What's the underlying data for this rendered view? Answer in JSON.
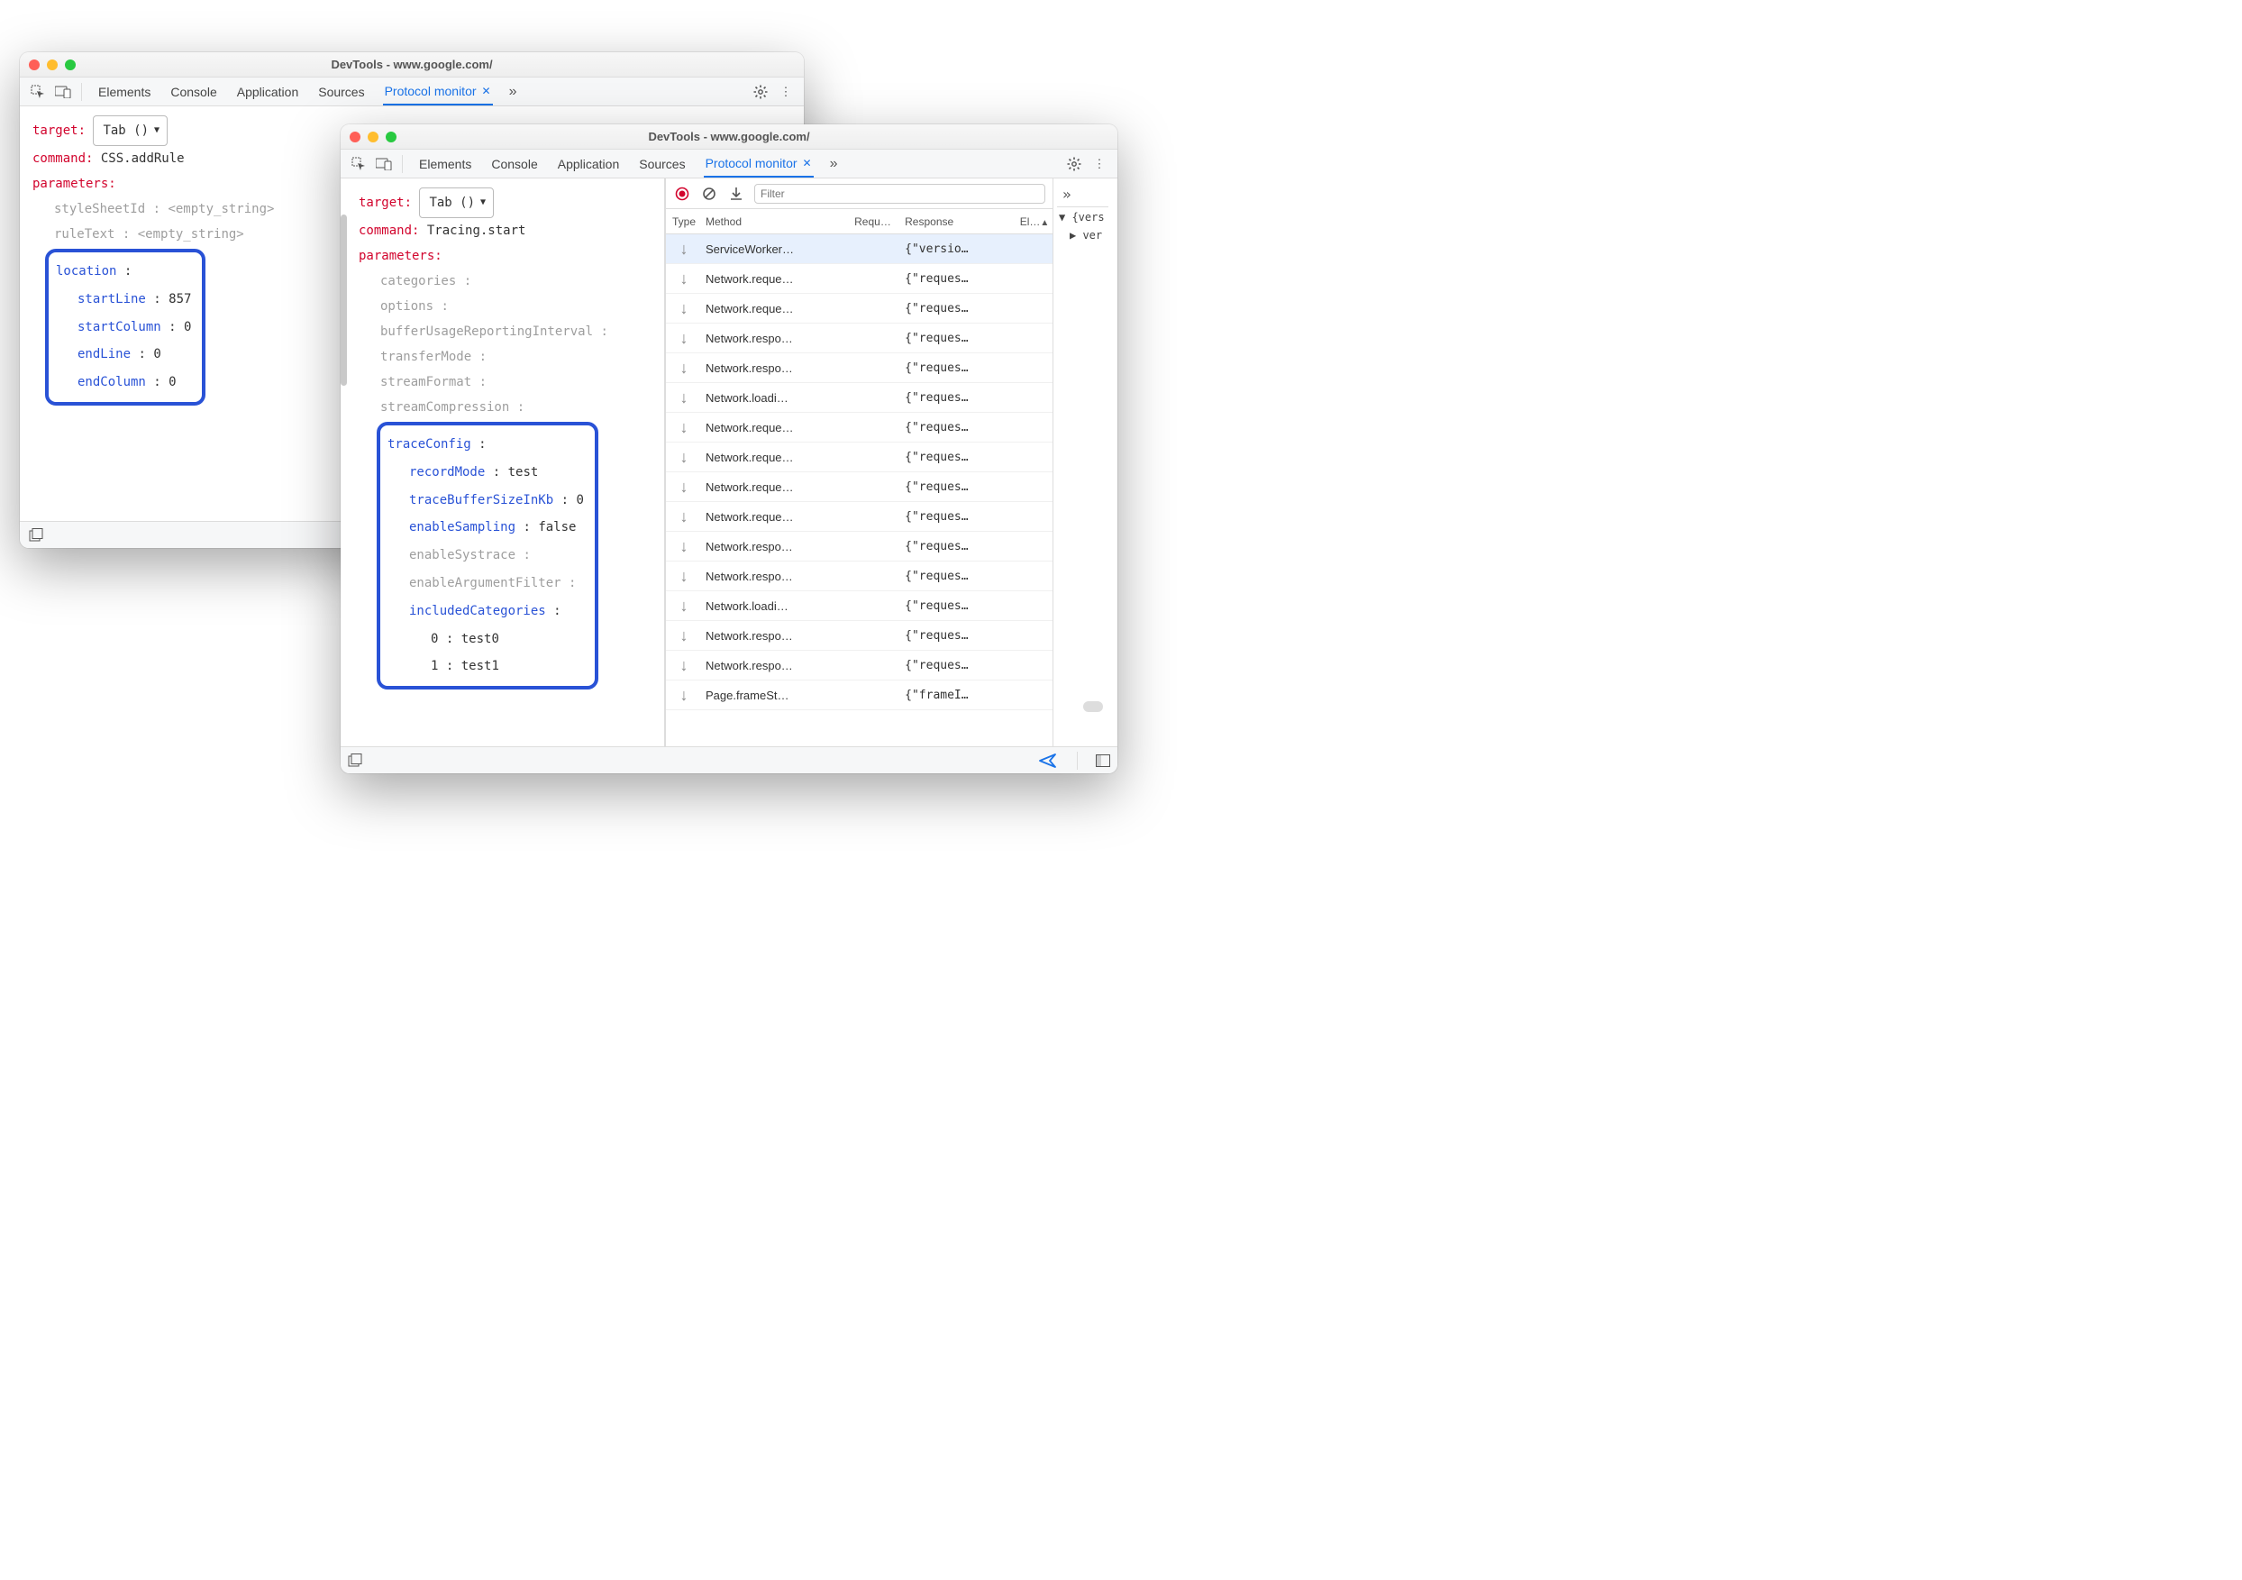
{
  "win1": {
    "title": "DevTools - www.google.com/",
    "tabs": [
      "Elements",
      "Console",
      "Application",
      "Sources",
      "Protocol monitor"
    ],
    "activeTab": "Protocol monitor",
    "editor": {
      "target_label": "target:",
      "target_select": "Tab ()",
      "command_label": "command:",
      "command_value": "CSS.addRule",
      "parameters_label": "parameters:",
      "params": [
        {
          "key": "styleSheetId",
          "val": "<empty_string>"
        },
        {
          "key": "ruleText",
          "val": "<empty_string>"
        }
      ],
      "highlight": {
        "key": "location",
        "fields": [
          {
            "key": "startLine",
            "val": "857"
          },
          {
            "key": "startColumn",
            "val": "0"
          },
          {
            "key": "endLine",
            "val": "0"
          },
          {
            "key": "endColumn",
            "val": "0"
          }
        ]
      }
    }
  },
  "win2": {
    "title": "DevTools - www.google.com/",
    "tabs": [
      "Elements",
      "Console",
      "Application",
      "Sources",
      "Protocol monitor"
    ],
    "activeTab": "Protocol monitor",
    "editor": {
      "target_label": "target:",
      "target_select": "Tab ()",
      "command_label": "command:",
      "command_value": "Tracing.start",
      "parameters_label": "parameters:",
      "params_plain": [
        "categories",
        "options",
        "bufferUsageReportingInterval",
        "transferMode",
        "streamFormat",
        "streamCompression"
      ],
      "highlight": {
        "key": "traceConfig",
        "fields_blue": [
          {
            "key": "recordMode",
            "val": "test"
          },
          {
            "key": "traceBufferSizeInKb",
            "val": "0"
          },
          {
            "key": "enableSampling",
            "val": "false"
          }
        ],
        "fields_gray": [
          "enableSystrace",
          "enableArgumentFilter"
        ],
        "included": {
          "key": "includedCategories",
          "items": [
            {
              "idx": "0",
              "val": "test0"
            },
            {
              "idx": "1",
              "val": "test1"
            }
          ]
        }
      }
    },
    "pp": {
      "filter_placeholder": "Filter",
      "cols": {
        "type": "Type",
        "method": "Method",
        "req": "Requ…",
        "resp": "Response",
        "el": "El…"
      },
      "rows": [
        {
          "method": "ServiceWorker…",
          "resp": "{\"versio…",
          "selected": true
        },
        {
          "method": "Network.reque…",
          "resp": "{\"reques…"
        },
        {
          "method": "Network.reque…",
          "resp": "{\"reques…"
        },
        {
          "method": "Network.respo…",
          "resp": "{\"reques…"
        },
        {
          "method": "Network.respo…",
          "resp": "{\"reques…"
        },
        {
          "method": "Network.loadi…",
          "resp": "{\"reques…"
        },
        {
          "method": "Network.reque…",
          "resp": "{\"reques…"
        },
        {
          "method": "Network.reque…",
          "resp": "{\"reques…"
        },
        {
          "method": "Network.reque…",
          "resp": "{\"reques…"
        },
        {
          "method": "Network.reque…",
          "resp": "{\"reques…"
        },
        {
          "method": "Network.respo…",
          "resp": "{\"reques…"
        },
        {
          "method": "Network.respo…",
          "resp": "{\"reques…"
        },
        {
          "method": "Network.loadi…",
          "resp": "{\"reques…"
        },
        {
          "method": "Network.respo…",
          "resp": "{\"reques…"
        },
        {
          "method": "Network.respo…",
          "resp": "{\"reques…"
        },
        {
          "method": "Page.frameSt…",
          "resp": "{\"frameI…"
        }
      ],
      "tree": {
        "root": "{vers",
        "child": "ver"
      }
    }
  }
}
